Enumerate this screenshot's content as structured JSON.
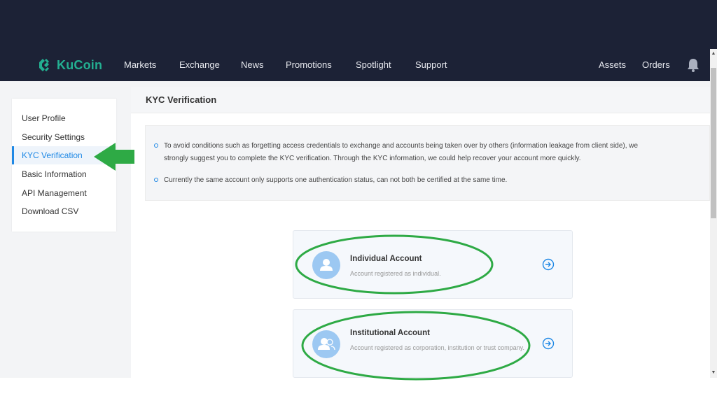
{
  "navbar": {
    "logo_text": "KuCoin",
    "items": [
      "Markets",
      "Exchange",
      "News",
      "Promotions",
      "Spotlight",
      "Support"
    ],
    "right_items": [
      "Assets",
      "Orders"
    ],
    "bell_icon": "bell-icon"
  },
  "sidebar": {
    "items": [
      {
        "label": "User Profile",
        "active": false
      },
      {
        "label": "Security Settings",
        "active": false
      },
      {
        "label": "KYC Verification",
        "active": true
      },
      {
        "label": "Basic Information",
        "active": false
      },
      {
        "label": "API Management",
        "active": false
      },
      {
        "label": "Download CSV",
        "active": false
      }
    ]
  },
  "main": {
    "title": "KYC Verification",
    "notices": [
      {
        "line1": "To avoid conditions such as forgetting access credentials to exchange and accounts being taken over by others (information leakage from client side), we",
        "line2": "strongly suggest you to complete the KYC verification. Through the KYC information, we could help recover your account more quickly."
      },
      {
        "line1": "Currently the same account only supports one authentication status, can not both be certified at the same time.",
        "line2": ""
      }
    ],
    "cards": [
      {
        "title": "Individual Account",
        "desc": "Account registered as individual.",
        "icon": "user-icon"
      },
      {
        "title": "Institutional Account",
        "desc": "Account registered as corporation, institution or trust company.",
        "icon": "users-icon"
      }
    ]
  },
  "colors": {
    "navbar_bg": "#1c2236",
    "brand_green": "#23af91",
    "accent_blue": "#1e88e5",
    "annotation_green": "#2eaa45"
  }
}
